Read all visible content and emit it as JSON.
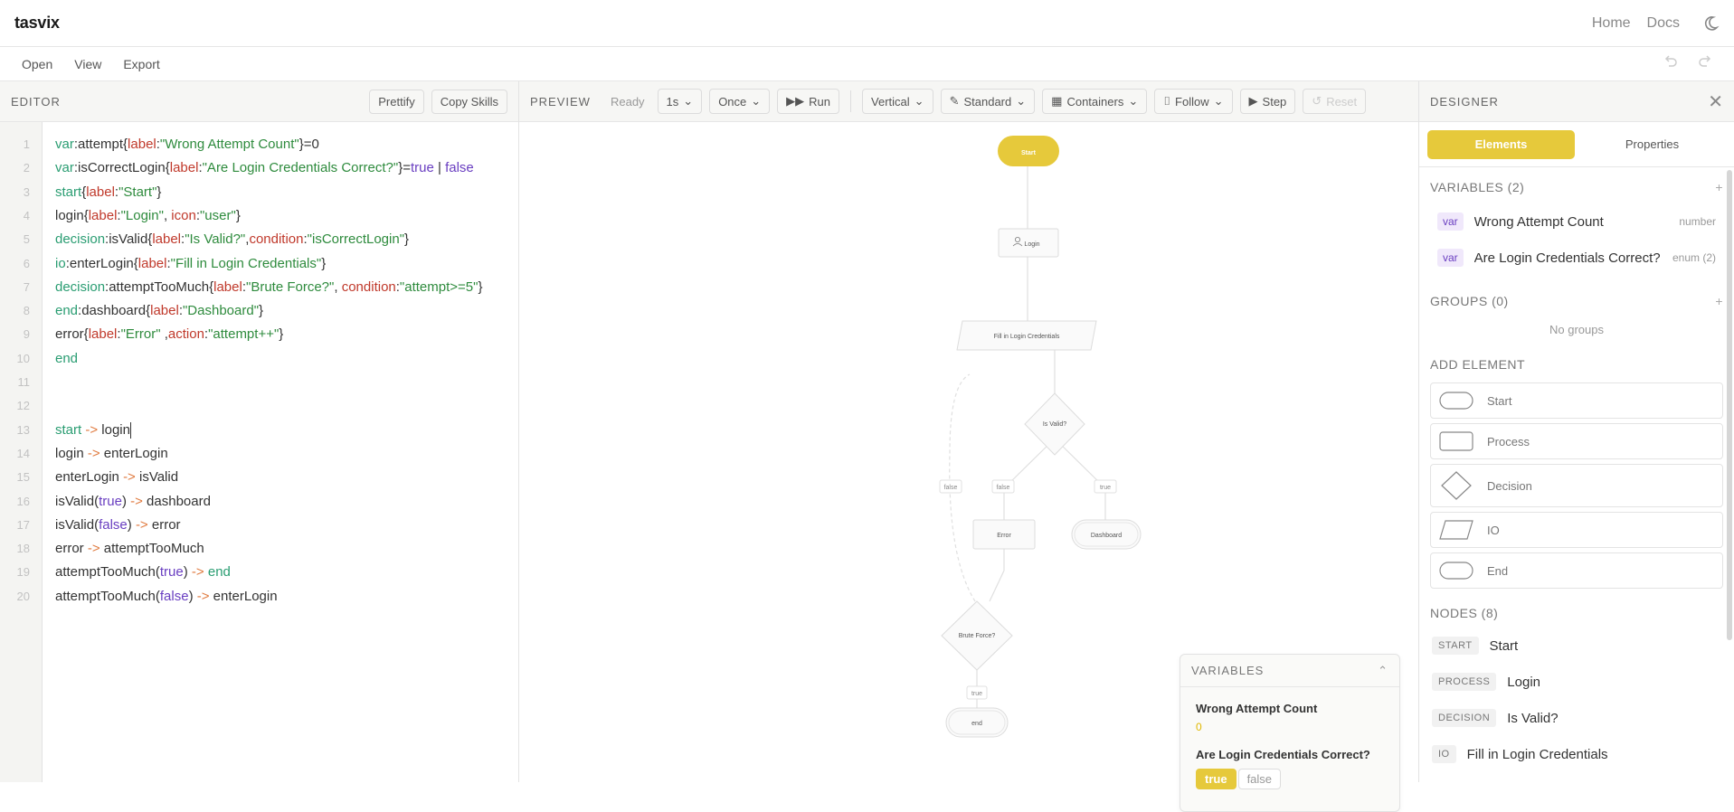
{
  "app": {
    "brand": "tasvix",
    "nav": [
      "Home",
      "Docs"
    ]
  },
  "menu": [
    "Open",
    "View",
    "Export"
  ],
  "editor": {
    "title": "EDITOR",
    "buttons": [
      "Prettify",
      "Copy Skills"
    ],
    "lines": [
      "var:attempt{label:\"Wrong Attempt Count\"}=0",
      "var:isCorrectLogin{label:\"Are Login Credentials Correct?\"}=true | false",
      "start{label:\"Start\"}",
      "login{label:\"Login\", icon:\"user\"}",
      "decision:isValid{label:\"Is Valid?\",condition:\"isCorrectLogin\"}",
      "io:enterLogin{label:\"Fill in Login Credentials\"}",
      "decision:attemptTooMuch{label:\"Brute Force?\", condition:\"attempt>=5\"}",
      "end:dashboard{label:\"Dashboard\"}",
      "error{label:\"Error\" ,action:\"attempt++\"}",
      "end",
      "",
      "",
      "start -> login",
      "login -> enterLogin",
      "enterLogin -> isValid",
      "isValid(true) -> dashboard",
      "isValid(false) -> error",
      "error -> attemptTooMuch",
      "attemptTooMuch(true) -> end",
      "attemptTooMuch(false) -> enterLogin"
    ]
  },
  "preview": {
    "title": "PREVIEW",
    "status": "Ready",
    "speed": "1s",
    "mode": "Once",
    "run": "Run",
    "layout": "Vertical",
    "style": "Standard",
    "containers": "Containers",
    "follow": "Follow",
    "step": "Step",
    "reset": "Reset",
    "nodes": {
      "start": "Start",
      "login": "Login",
      "enter": "Fill in Login Credentials",
      "isvalid": "Is Valid?",
      "error": "Error",
      "dashboard": "Dashboard",
      "brute": "Brute Force?",
      "end": "end"
    },
    "edge_labels": {
      "false1": "false",
      "false2": "false",
      "true1": "true",
      "true2": "true"
    },
    "variables_box": {
      "title": "VARIABLES",
      "items": [
        {
          "name": "Wrong Attempt Count",
          "value": "0"
        },
        {
          "name": "Are Login Credentials Correct?",
          "options": [
            "true",
            "false"
          ],
          "selected": "true"
        }
      ]
    }
  },
  "designer": {
    "title": "DESIGNER",
    "tabs": [
      "Elements",
      "Properties"
    ],
    "variables_header": "VARIABLES (2)",
    "variables": [
      {
        "tag": "var",
        "name": "Wrong Attempt Count",
        "type": "number"
      },
      {
        "tag": "var",
        "name": "Are Login Credentials Correct?",
        "type": "enum (2)"
      }
    ],
    "groups_header": "GROUPS (0)",
    "no_groups": "No groups",
    "add_header": "ADD ELEMENT",
    "add_elements": [
      "Start",
      "Process",
      "Decision",
      "IO",
      "End"
    ],
    "nodes_header": "NODES (8)",
    "nodes": [
      {
        "tag": "START",
        "label": "Start"
      },
      {
        "tag": "PROCESS",
        "label": "Login"
      },
      {
        "tag": "DECISION",
        "label": "Is Valid?"
      },
      {
        "tag": "IO",
        "label": "Fill in Login Credentials"
      }
    ]
  },
  "colors": {
    "accent": "#e6c93b",
    "keyword": "#2a9d72",
    "attribute": "#c0392b",
    "string": "#2e8b3d",
    "boolean": "#6a3fc1"
  }
}
